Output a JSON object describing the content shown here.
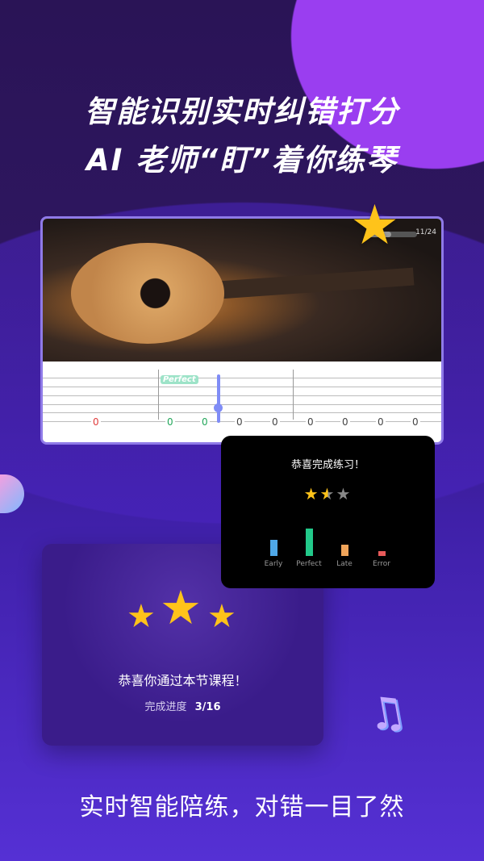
{
  "headline": {
    "line1": "智能识别实时纠错打分",
    "line2": "AI 老师“盯”着你练琴"
  },
  "video": {
    "counter": "11/24",
    "progress": 0.46
  },
  "tab": {
    "badge": "Perfect",
    "notes": [
      {
        "v": "0",
        "c": "#e03b3b"
      },
      {
        "v": "0",
        "c": "#22a65a"
      },
      {
        "v": "0",
        "c": "#22a65a"
      },
      {
        "v": "0",
        "c": "#444"
      },
      {
        "v": "0",
        "c": "#444"
      },
      {
        "v": "0",
        "c": "#444"
      },
      {
        "v": "0",
        "c": "#444"
      },
      {
        "v": "0",
        "c": "#444"
      },
      {
        "v": "0",
        "c": "#444"
      }
    ]
  },
  "practice_result": {
    "title": "恭喜完成练习！",
    "rating": 1.5,
    "rating_max": 3,
    "chart_data": {
      "type": "bar",
      "categories": [
        "Early",
        "Perfect",
        "Late",
        "Error"
      ],
      "values": [
        0.6,
        1.0,
        0.4,
        0.18
      ],
      "colors": [
        "#4fa8e8",
        "#22c98a",
        "#f0a45a",
        "#e85a5a"
      ]
    }
  },
  "course_result": {
    "title": "恭喜你通过本节课程！",
    "progress_label": "完成进度",
    "progress_value": "3/16",
    "stars": 3
  },
  "tagline": "实时智能陪练，对错一目了然",
  "colors": {
    "accent": "#9a3ef0",
    "star": "#ffc31a"
  }
}
